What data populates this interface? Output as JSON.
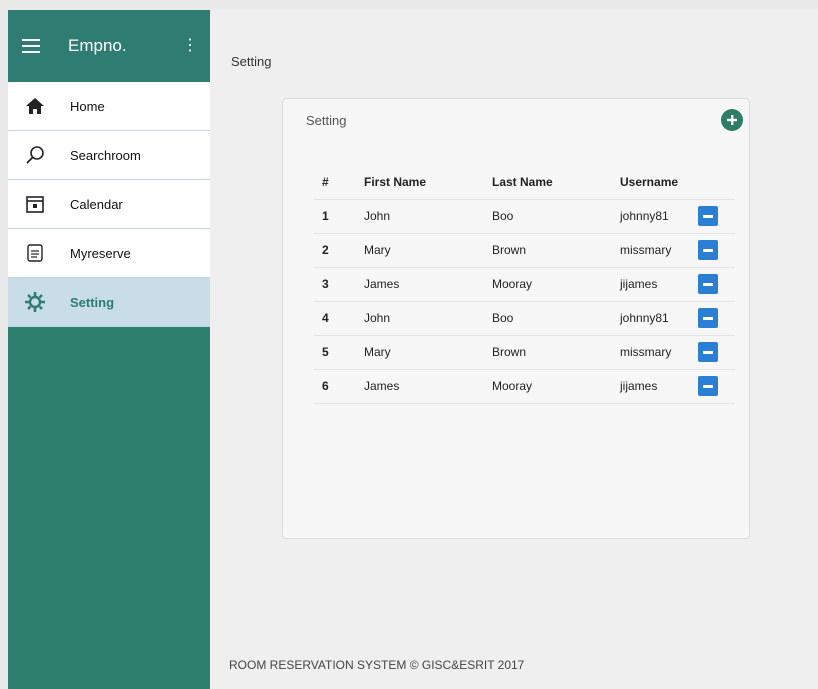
{
  "sidebar": {
    "brand": "Empno.",
    "kebab": "⋮",
    "items": [
      {
        "label": "Home"
      },
      {
        "label": "Searchroom"
      },
      {
        "label": "Calendar"
      },
      {
        "label": "Myreserve"
      },
      {
        "label": "Setting"
      }
    ]
  },
  "main": {
    "page_title": "Setting",
    "card": {
      "title": "Setting",
      "headers": [
        "#",
        "First Name",
        "Last Name",
        "Username"
      ],
      "rows": [
        {
          "num": "1",
          "first": "John",
          "last": "Boo",
          "user": "johnny81"
        },
        {
          "num": "2",
          "first": "Mary",
          "last": "Brown",
          "user": "missmary"
        },
        {
          "num": "3",
          "first": "James",
          "last": "Mooray",
          "user": "jijames"
        },
        {
          "num": "4",
          "first": "John",
          "last": "Boo",
          "user": "johnny81"
        },
        {
          "num": "5",
          "first": "Mary",
          "last": "Brown",
          "user": "missmary"
        },
        {
          "num": "6",
          "first": "James",
          "last": "Mooray",
          "user": "jijames"
        }
      ]
    },
    "footer": "ROOM RESERVATION SYSTEM © GISC&ESRIT 2017"
  },
  "colors": {
    "sidebar": "#2f7f6f",
    "header": "#2e7c72",
    "active_item": "#c9dde8",
    "add_button": "#2e7c64",
    "remove_button": "#2a7fd4"
  }
}
